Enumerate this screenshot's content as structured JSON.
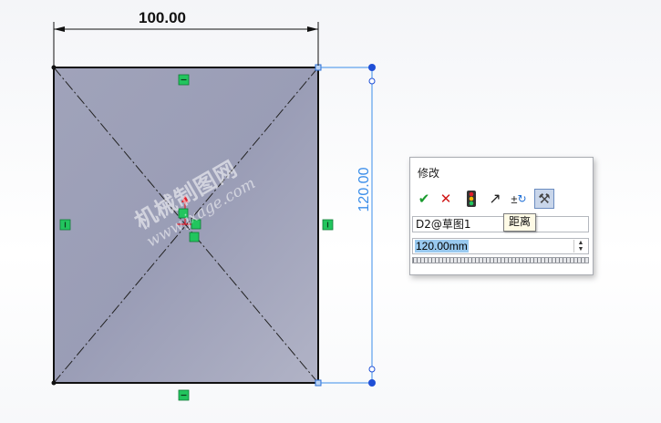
{
  "sketch": {
    "horizontal_dimension": "100.00",
    "vertical_dimension": "120.00",
    "colors": {
      "rectangle_fill": "#a3a6bd",
      "dimension_blue": "#3b8eea",
      "relation_green": "#22c55e",
      "origin_red": "#e11d2a"
    }
  },
  "watermark": {
    "text_cn": "机械制图网",
    "text_url": "www.jxage.com"
  },
  "modify_dialog": {
    "title": "修改",
    "toolbar": [
      {
        "icon": "check-icon",
        "glyph": "✔"
      },
      {
        "icon": "close-icon",
        "glyph": "✕"
      },
      {
        "icon": "rebuild-icon",
        "glyph": "●"
      },
      {
        "icon": "arrow-icon",
        "glyph": "↗"
      },
      {
        "icon": "reverse-dimension-icon",
        "glyph": "±"
      },
      {
        "icon": "mark-dimension-icon",
        "glyph": "⚒"
      }
    ],
    "dimension_name": "D2@草图1",
    "value": "120.00mm",
    "tooltip": "距离"
  }
}
